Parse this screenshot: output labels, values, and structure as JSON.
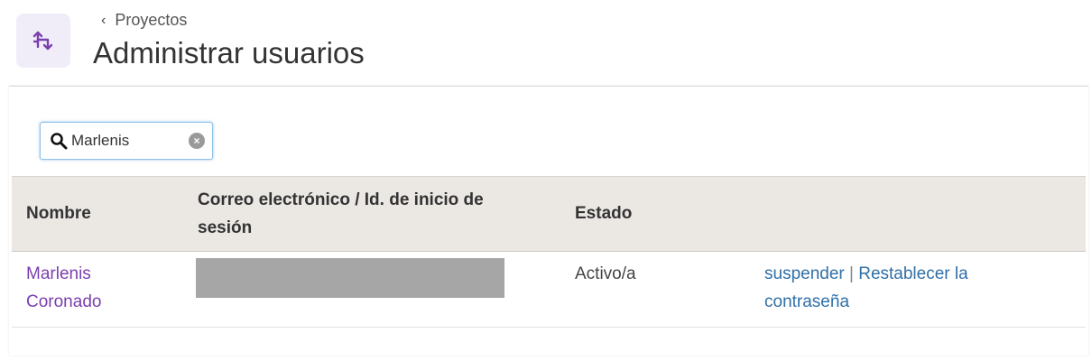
{
  "header": {
    "back_label": "Proyectos",
    "title": "Administrar usuarios",
    "icon": "transfer-arrows-icon"
  },
  "search": {
    "value": "Marlenis",
    "placeholder": ""
  },
  "table": {
    "columns": [
      "Nombre",
      "Correo electrónico / Id. de inicio de sesión",
      "Estado",
      ""
    ],
    "rows": [
      {
        "name": "Marlenis Coronado",
        "email": "",
        "status": "Activo/a",
        "actions": {
          "suspend": "suspender",
          "separator": "|",
          "reset": "Restablecer la contraseña"
        }
      }
    ]
  },
  "colors": {
    "accent": "#7b3fb0",
    "link": "#2f6fa8",
    "header_bg": "#ebe8e4",
    "icon_bg": "#f1edf8"
  }
}
